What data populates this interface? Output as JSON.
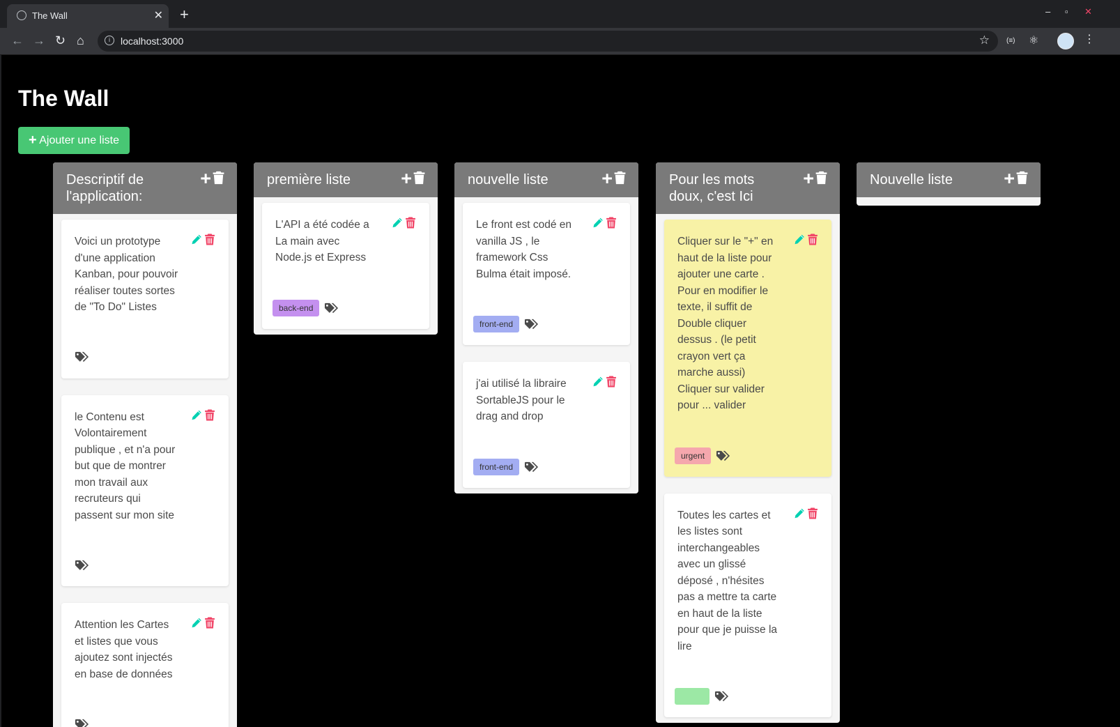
{
  "browser": {
    "tab_title": "The Wall",
    "tab_close": "✕",
    "new_tab": "+",
    "url": "localhost:3000",
    "back": "←",
    "forward": "→",
    "reload": "↻",
    "home": "⌂",
    "bookmark_star": "☆",
    "min": "‒",
    "restore": "▫",
    "close": "✕",
    "ext1": "(≡)",
    "ext2": "⚛",
    "menu": "⋮"
  },
  "page": {
    "title": "The Wall",
    "add_list_label": "Ajouter une liste",
    "add_list_plus": "+"
  },
  "colors": {
    "add_button": "#48c774",
    "column_header": "#7a7a7a",
    "edit_icon": "#00d1b2",
    "delete_icon": "#f14668",
    "highlight_card": "#f8f2a6"
  },
  "lists": [
    {
      "title": "Descriptif de l'application:",
      "cards": [
        {
          "text": "Voici un prototype d'une application Kanban, pour pouvoir réaliser toutes sortes de \"To Do\" Listes",
          "tags": []
        },
        {
          "text": "le Contenu est Volontairement publique , et n'a pour but que de montrer mon travail aux recruteurs qui passent sur mon site",
          "tags": []
        },
        {
          "text": "Attention les Cartes et listes que vous ajoutez sont injectés en base de données",
          "tags": []
        }
      ]
    },
    {
      "title": "première liste",
      "cards": [
        {
          "text": "L'API a été codée a La main avec Node.js et Express",
          "tags": [
            {
              "label": "back-end",
              "color": "#c490ef"
            }
          ]
        }
      ]
    },
    {
      "title": "nouvelle liste",
      "cards": [
        {
          "text": "Le front est codé en vanilla JS , le framework Css Bulma était imposé.",
          "tags": [
            {
              "label": "front-end",
              "color": "#a3adf2"
            }
          ]
        },
        {
          "text": "j'ai utilisé la libraire SortableJS pour le drag and drop",
          "tags": [
            {
              "label": "front-end",
              "color": "#a3adf2"
            }
          ]
        }
      ]
    },
    {
      "title": "Pour les mots doux, c'est Ici",
      "cards": [
        {
          "text": "Cliquer sur le \"+\" en haut de la liste pour ajouter une carte . Pour en modifier le texte, il suffit de Double cliquer dessus . (le petit crayon vert ça marche aussi) Cliquer sur valider pour ... valider",
          "tags": [
            {
              "label": "urgent",
              "color": "#f5a7ad"
            }
          ],
          "highlight": true
        },
        {
          "text": "Toutes les cartes et les listes sont interchangeables avec un glissé déposé , n'hésites pas a mettre ta carte en haut de la liste pour que je puisse la lire",
          "tags": [
            {
              "label": "",
              "color": "#9ce8a5"
            }
          ]
        }
      ]
    },
    {
      "title": "Nouvelle liste",
      "cards": []
    }
  ]
}
